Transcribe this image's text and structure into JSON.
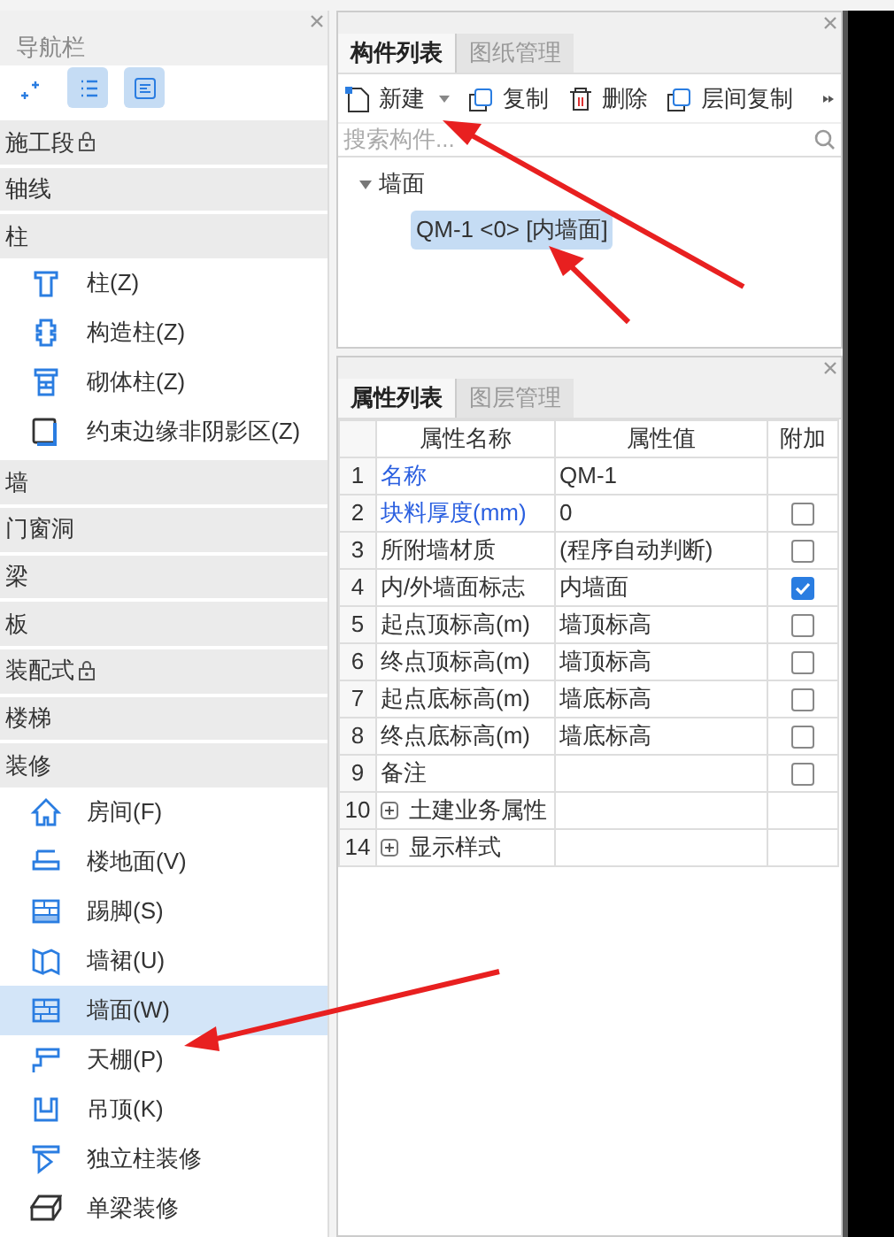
{
  "nav_panel": {
    "title": "导航栏",
    "toolbar": [
      {
        "selected": false
      },
      {
        "selected": true
      },
      {
        "selected": true
      }
    ],
    "groups": [
      {
        "label": "施工段",
        "locked": true
      },
      {
        "label": "轴线",
        "locked": false
      },
      {
        "label": "柱",
        "locked": false,
        "items": [
          {
            "label": "柱(Z)",
            "selected": false
          },
          {
            "label": "构造柱(Z)",
            "selected": false
          },
          {
            "label": "砌体柱(Z)",
            "selected": false
          },
          {
            "label": "约束边缘非阴影区(Z)",
            "selected": false
          }
        ]
      },
      {
        "label": "墙",
        "locked": false
      },
      {
        "label": "门窗洞",
        "locked": false
      },
      {
        "label": "梁",
        "locked": false
      },
      {
        "label": "板",
        "locked": false
      },
      {
        "label": "装配式",
        "locked": true
      },
      {
        "label": "楼梯",
        "locked": false
      },
      {
        "label": "装修",
        "locked": false,
        "items": [
          {
            "label": "房间(F)",
            "selected": false
          },
          {
            "label": "楼地面(V)",
            "selected": false
          },
          {
            "label": "踢脚(S)",
            "selected": false
          },
          {
            "label": "墙裙(U)",
            "selected": false
          },
          {
            "label": "墙面(W)",
            "selected": true
          },
          {
            "label": "天棚(P)",
            "selected": false
          },
          {
            "label": "吊顶(K)",
            "selected": false
          },
          {
            "label": "独立柱装修",
            "selected": false
          },
          {
            "label": "单梁装修",
            "selected": false
          }
        ]
      }
    ]
  },
  "component_panel": {
    "tabs": [
      {
        "label": "构件列表",
        "selected": true
      },
      {
        "label": "图纸管理",
        "selected": false
      }
    ],
    "toolbar": [
      {
        "label": "新建",
        "kind": "new"
      },
      {
        "label": "复制",
        "kind": "copy"
      },
      {
        "label": "删除",
        "kind": "delete"
      },
      {
        "label": "层间复制",
        "kind": "floor-copy"
      }
    ],
    "search": {
      "placeholder": "搜索构件..."
    },
    "tree": {
      "label": "墙面",
      "expanded": true,
      "children": [
        {
          "label": "QM-1 <0> [内墙面]",
          "selected": true
        }
      ]
    }
  },
  "property_panel": {
    "tabs": [
      {
        "label": "属性列表",
        "selected": true
      },
      {
        "label": "图层管理",
        "selected": false
      }
    ],
    "columns": [
      "属性名称",
      "属性值",
      "附加"
    ],
    "rows": [
      {
        "index": "1",
        "name": "名称",
        "value": "QM-1",
        "public": true
      },
      {
        "index": "2",
        "name": "块料厚度(mm)",
        "value": "0",
        "public": true,
        "attached": false
      },
      {
        "index": "3",
        "name": "所附墙材质",
        "value": "(程序自动判断)",
        "public": false,
        "attached": false
      },
      {
        "index": "4",
        "name": "内/外墙面标志",
        "value": "内墙面",
        "public": false,
        "attached": true
      },
      {
        "index": "5",
        "name": "起点顶标高(m)",
        "value": "墙顶标高",
        "public": false,
        "attached": false
      },
      {
        "index": "6",
        "name": "终点顶标高(m)",
        "value": "墙顶标高",
        "public": false,
        "attached": false
      },
      {
        "index": "7",
        "name": "起点底标高(m)",
        "value": "墙底标高",
        "public": false,
        "attached": false
      },
      {
        "index": "8",
        "name": "终点底标高(m)",
        "value": "墙底标高",
        "public": false,
        "attached": false
      },
      {
        "index": "9",
        "name": "备注",
        "public": false,
        "attached": false
      },
      {
        "index": "10",
        "name": "土建业务属性",
        "kind": "group",
        "expanded": false
      },
      {
        "index": "14",
        "name": "显示样式",
        "kind": "group",
        "expanded": false
      }
    ]
  }
}
